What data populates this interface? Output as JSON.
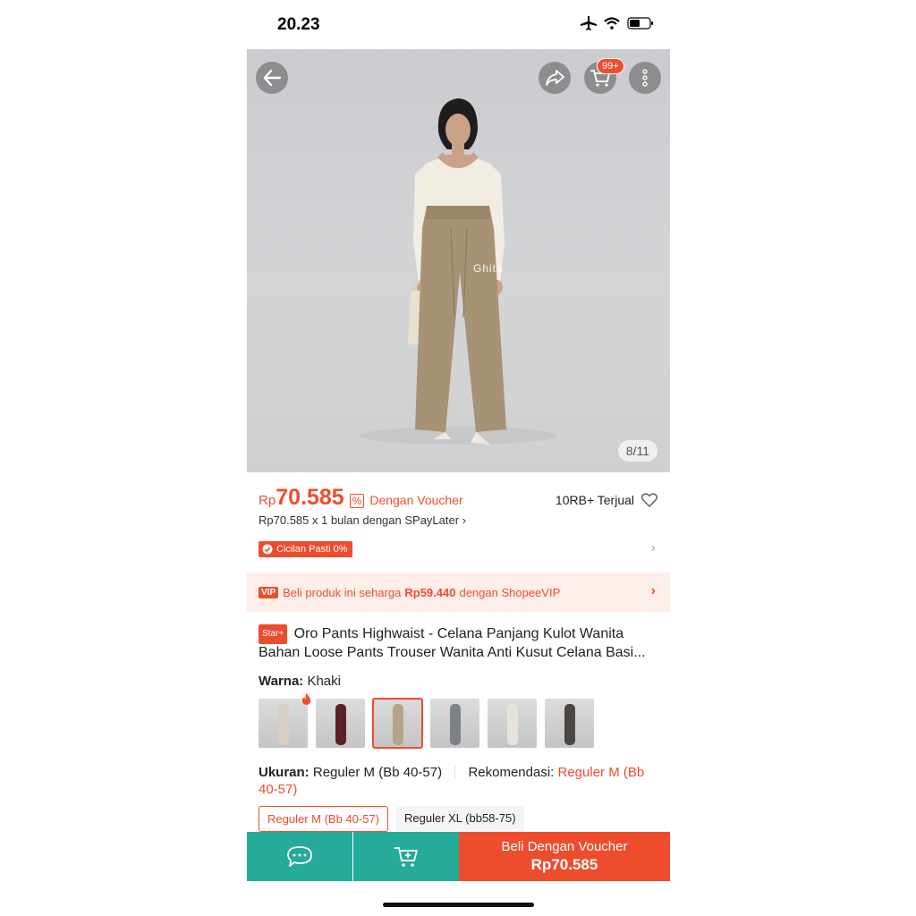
{
  "status_bar": {
    "time": "20.23"
  },
  "hero": {
    "image_counter": "8/11",
    "cart_badge": "99+",
    "watermark": "Ghita",
    "icons": [
      "back-arrow-icon",
      "share-icon",
      "cart-icon",
      "more-icon"
    ]
  },
  "price": {
    "currency": "Rp",
    "amount": "70.585",
    "voucher_text": "Dengan Voucher",
    "sold": "10RB+ Terjual",
    "installment": "Rp70.585 x 1 bulan dengan SPayLater",
    "installment_chevron": "›",
    "cicilan_badge": "Cicilan Pasti 0%"
  },
  "vip_banner": {
    "badge": "VIP",
    "prefix": "Beli produk ini seharga",
    "price": "Rp59.440",
    "suffix": "dengan ShopeeVIP"
  },
  "product": {
    "badge": "Star+",
    "title": "Oro Pants Highwaist - Celana Panjang Kulot Wanita Bahan Loose Pants Trouser Wanita Anti Kusut Celana Basi..."
  },
  "variant": {
    "label": "Warna:",
    "value": "Khaki",
    "selected_index": 2,
    "thumb_colors": [
      "#d8cfc2",
      "#5a2128",
      "#b5a38a",
      "#7e8187",
      "#e8e3da",
      "#4c4642"
    ]
  },
  "size": {
    "label": "Ukuran:",
    "value": "Reguler M (Bb 40-57)",
    "rec_label": "Rekomendasi:",
    "rec_value": "Reguler M (Bb 40-57)",
    "options": [
      "Reguler M (Bb 40-57)",
      "Reguler XL (bb58-75)"
    ]
  },
  "bottom_bar": {
    "buy_label": "Beli Dengan Voucher",
    "buy_price": "Rp70.585"
  },
  "colors": {
    "accent": "#ee4d2d",
    "teal": "#26aa99"
  }
}
